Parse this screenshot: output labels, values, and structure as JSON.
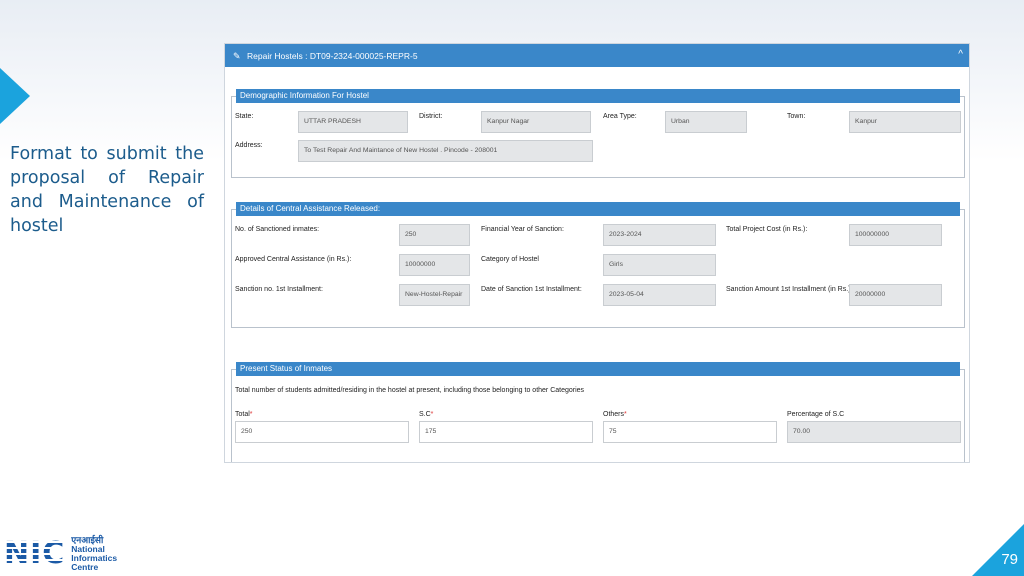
{
  "slide": {
    "caption": "Format to submit the proposal of Repair and Maintenance of hostel",
    "page_number": "79",
    "logo": {
      "hindi": "एनआईसी",
      "line1": "National",
      "line2": "Informatics",
      "line3": "Centre",
      "letters": "NIC"
    }
  },
  "form": {
    "header_title": "Repair Hostels : DT09-2324-000025-REPR-5",
    "collapse_icon": "^",
    "demographic": {
      "title": "Demographic Information For Hostel",
      "state_label": "State:",
      "state_value": "UTTAR PRADESH",
      "district_label": "District:",
      "district_value": "Kanpur Nagar",
      "area_label": "Area Type:",
      "area_value": "Urban",
      "town_label": "Town:",
      "town_value": "Kanpur",
      "address_label": "Address:",
      "address_value": "To Test Repair And Maintance of New Hostel . Pincode - 208001"
    },
    "assistance": {
      "title": "Details of Central Assistance Released:",
      "inmates_label": "No. of Sanctioned inmates:",
      "inmates_value": "250",
      "fy_label": "Financial Year of Sanction:",
      "fy_value": "2023-2024",
      "cost_label": "Total Project Cost (in Rs.):",
      "cost_value": "100000000",
      "approved_label": "Approved Central Assistance (in Rs.):",
      "approved_value": "10000000",
      "category_label": "Category of Hostel",
      "category_value": "Girls",
      "sanction_no_label": "Sanction no. 1st Installment:",
      "sanction_no_value": "New-Hostel-Repair",
      "date_label": "Date of Sanction 1st Installment:",
      "date_value": "2023-05-04",
      "amount_label": "Sanction Amount 1st Installment (in Rs.):",
      "amount_value": "20000000"
    },
    "present_status": {
      "title": "Present Status of Inmates",
      "note": "Total number of students admitted/residing in the hostel at present, including those belonging to other Categories",
      "total_label": "Total",
      "total_value": "250",
      "sc_label": "S.C",
      "sc_value": "175",
      "others_label": "Others",
      "others_value": "75",
      "pct_label": "Percentage of S.C",
      "pct_value": "70.00"
    }
  }
}
